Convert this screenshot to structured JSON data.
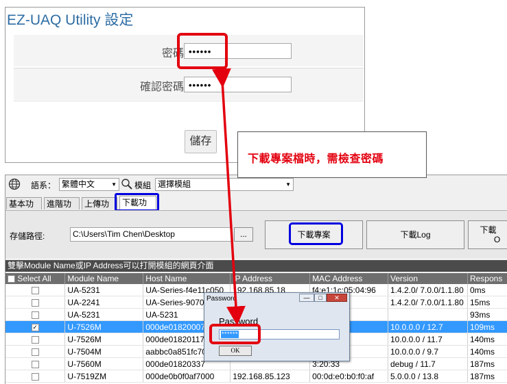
{
  "settings": {
    "title": "EZ-UAQ Utility 設定",
    "password_label": "密碼",
    "password_value": "••••••",
    "confirm_label": "確認密碼",
    "confirm_value": "••••••",
    "save_label": "儲存"
  },
  "callout": {
    "text": "下載專案檔時，需檢查密碼"
  },
  "toolbar": {
    "language_label": "語系：",
    "language_value": "繁體中文",
    "module_label": "模組",
    "module_value": "選擇模組"
  },
  "tabs": [
    "基本功能",
    "進階功能",
    "上傳功能",
    "下載功能"
  ],
  "panel": {
    "path_label": "存儲路徑:",
    "path_value": "C:\\Users\\Tim Chen\\Desktop",
    "browse_label": "...",
    "download_project": "下載專案",
    "download_log": "下載Log",
    "download_partial": "下載",
    "download_partial2": "O"
  },
  "infobar": "雙擊Module Name或IP Address可以打開模組的網頁介面",
  "table": {
    "headers": [
      "Select All",
      "Module Name",
      "Host Name",
      "IP Address",
      "MAC Address",
      "Version",
      "Respons"
    ],
    "rows": [
      {
        "checked": false,
        "module": "UA-5231",
        "host": "UA-Series-f4e11c050",
        "ip": "192.168.85.18",
        "mac": "f4:e1:1c:05:04:96",
        "version": "1.4.2.0/ 7.0.0/1.1.80",
        "response": "0ms"
      },
      {
        "checked": false,
        "module": "UA-2241",
        "host": "UA-Series-9070",
        "ip": "",
        "mac": ":89:55",
        "version": "1.4.2.0/ 7.0.0/1.1.80",
        "response": "15ms"
      },
      {
        "checked": false,
        "module": "UA-5231",
        "host": "UA-5231",
        "ip": "",
        "mac": "",
        "version": "",
        "response": "93ms"
      },
      {
        "checked": true,
        "module": "U-7526M",
        "host": "000de01820007",
        "ip": "",
        "mac": "3:20:00",
        "version": "10.0.0.0 / 12.7",
        "response": "109ms",
        "selected": true
      },
      {
        "checked": false,
        "module": "U-7526M",
        "host": "000de01820117",
        "ip": "",
        "mac": "3:20:11",
        "version": "10.0.0.0 / 11.7",
        "response": "140ms"
      },
      {
        "checked": false,
        "module": "U-7504M",
        "host": "aabbc0a851fc70",
        "ip": "",
        "mac": "3:20:09",
        "version": "10.0.0.0 / 9.7",
        "response": "140ms"
      },
      {
        "checked": false,
        "module": "U-7560M",
        "host": "000de01820337",
        "ip": "",
        "mac": "3:20:33",
        "version": "debug / 11.7",
        "response": "187ms"
      },
      {
        "checked": false,
        "module": "U-7519ZM",
        "host": "000de0b0f0af7000",
        "ip": "192.168.85.123",
        "mac": "00:0d:e0:b0:f0:af",
        "version": "5.0.0.0 / 13.8",
        "response": "187ms"
      }
    ]
  },
  "dialog": {
    "caption": "Password",
    "prompt": "Password",
    "value": "******",
    "ok": "OK",
    "min": "—",
    "max": "□",
    "close": "✕"
  },
  "colors": {
    "highlight_red": "#e3000f",
    "highlight_blue": "#0000e0",
    "selection": "#3399ff"
  }
}
